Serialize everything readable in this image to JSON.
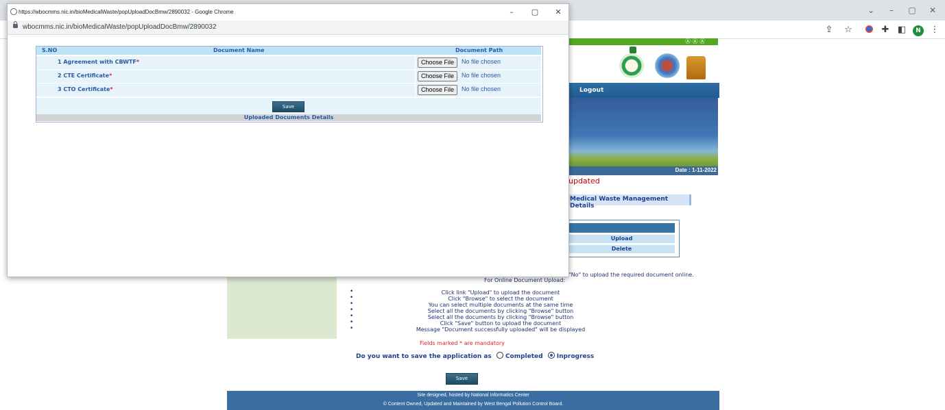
{
  "popup": {
    "title": "https://wbocmms.nic.in/bioMedicalWaste/popUploadDocBmw/2890032 - Google Chrome",
    "url": "wbocmms.nic.in/bioMedicalWaste/popUploadDocBmw/2890032",
    "table": {
      "headers": [
        "S.NO",
        "Document Name",
        "Document Path"
      ],
      "rows": [
        {
          "label": "1 Agreement with CBWTF",
          "req": "*",
          "button": "Choose File",
          "status": "No file chosen"
        },
        {
          "label": "2 CTE Certificate",
          "req": "*",
          "button": "Choose File",
          "status": "No file chosen"
        },
        {
          "label": "3 CTO Certificate",
          "req": "*",
          "button": "Choose File",
          "status": "No file chosen"
        }
      ],
      "save_label": "Save",
      "uploaded_heading": "Uploaded Documents Details"
    }
  },
  "browser": {
    "profile_initial": "N"
  },
  "page": {
    "aaa": "Ⓐ Ⓐ Ⓐ",
    "nav_logout": "Logout",
    "date": "Date : 1-11-2022",
    "updated_fragment": "updated",
    "section_tab": "Medical Waste Management Details",
    "link_upload": "Upload",
    "link_delete": "Delete",
    "no_line_fragment": "\"No\" to upload the required document online.",
    "online_title": "For Online Document Upload:",
    "instructions": [
      "Click link \"Upload\" to upload the document",
      "Click \"Browse\" to select the document",
      "You can select multiple documents at the same time",
      "Select all the documents by clicking \"Browse\" button",
      "Select all the documents by clicking \"Browse\" button",
      "Click \"Save\" button to upload the document",
      "Message \"Document successfully uploaded\" will be displayed"
    ],
    "mandatory_note": "Fields marked * are mandatory",
    "save_question": "Do you want to save the application as",
    "option_completed": "Completed",
    "option_inprogress": "Inprogress",
    "selected_option": "Inprogress",
    "save_label": "Save",
    "footer_line1": "Site designed, hosted by National Informatics Center",
    "footer_line2": "© Content Owned, Updated and Maintained by West Bengal Pollution Control Board."
  },
  "colors": {
    "header_blue": "#bfe3f6",
    "row_blue": "#e6f3fb",
    "text_blue": "#2a5aa0",
    "required_red": "#e02020",
    "footer_blue": "#3a6ea0",
    "green_bar": "#54a81f"
  }
}
